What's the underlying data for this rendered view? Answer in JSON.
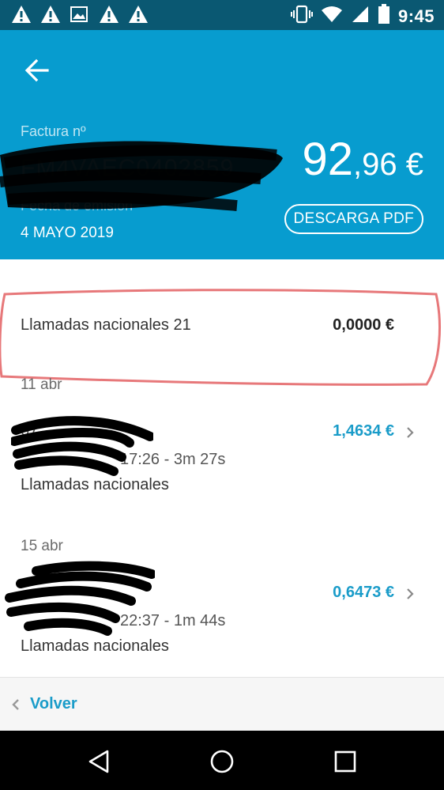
{
  "status_bar": {
    "time": "9:45",
    "icons": [
      "warning-icon",
      "warning-icon",
      "image-icon",
      "warning-icon",
      "warning-icon",
      "vibrate-icon",
      "wifi-icon",
      "signal-icon",
      "battery-icon"
    ]
  },
  "header": {
    "invoice_label": "Factura nº",
    "invoice_number": "FM4VAEC0402859",
    "issue_label": "Fecha de emisión",
    "issue_date": "4 MAYO 2019",
    "amount_int": "92",
    "amount_dec": ",96 €",
    "pdf_button": "DESCARGA PDF",
    "colors": {
      "background": "#079ccf",
      "status_bar": "#0a5872"
    }
  },
  "summary": {
    "label": "Llamadas nacionales 21",
    "amount": "0,0000 €"
  },
  "calls": [
    {
      "date": "11 abr",
      "number": "67",
      "meta": "17:26 - 3m 27s",
      "type": "Llamadas nacionales",
      "amount": "1,4634 €"
    },
    {
      "date": "15 abr",
      "number": "",
      "meta": "22:37 - 1m 44s",
      "type": "Llamadas nacionales",
      "amount": "0,6473 €"
    }
  ],
  "footer": {
    "back_label": "Volver"
  },
  "accent_color": "#1a9cc9"
}
